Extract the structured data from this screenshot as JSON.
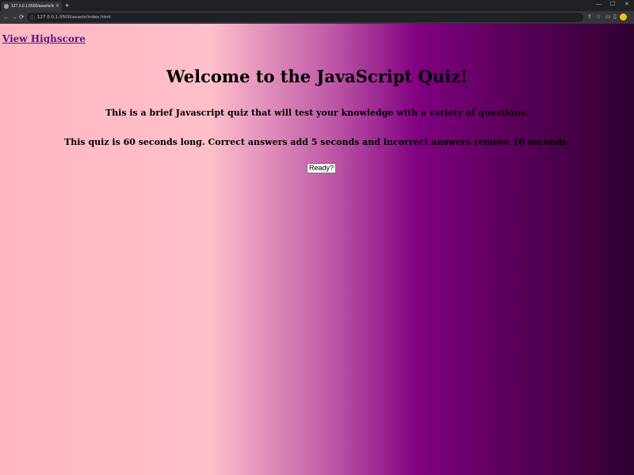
{
  "browser": {
    "tab_title": "127.0.0.1:5500/assets/index.html",
    "new_tab": "+",
    "url": "127.0.0.1:5500/assets/index.html",
    "window_controls": [
      "—",
      "☐",
      "✕"
    ],
    "nav": {
      "back": "←",
      "forward": "→",
      "reload": "⟳"
    }
  },
  "page": {
    "highscore_link": "View Highscore",
    "title": "Welcome to the JavaScript Quiz!",
    "intro": "This is a brief Javascript quiz that will test your knowledge with a variety of questions.",
    "rules": "This quiz is 60 seconds long. Correct answers add 5 seconds and incorrect answers remove 10 seconds.",
    "start_button": "Ready?"
  },
  "colors": {
    "gradient": [
      "#ffb6c1",
      "#ffc0cb",
      "#c05aa8",
      "#800080",
      "#5c005c",
      "#300030"
    ],
    "link": "#551a8b"
  }
}
